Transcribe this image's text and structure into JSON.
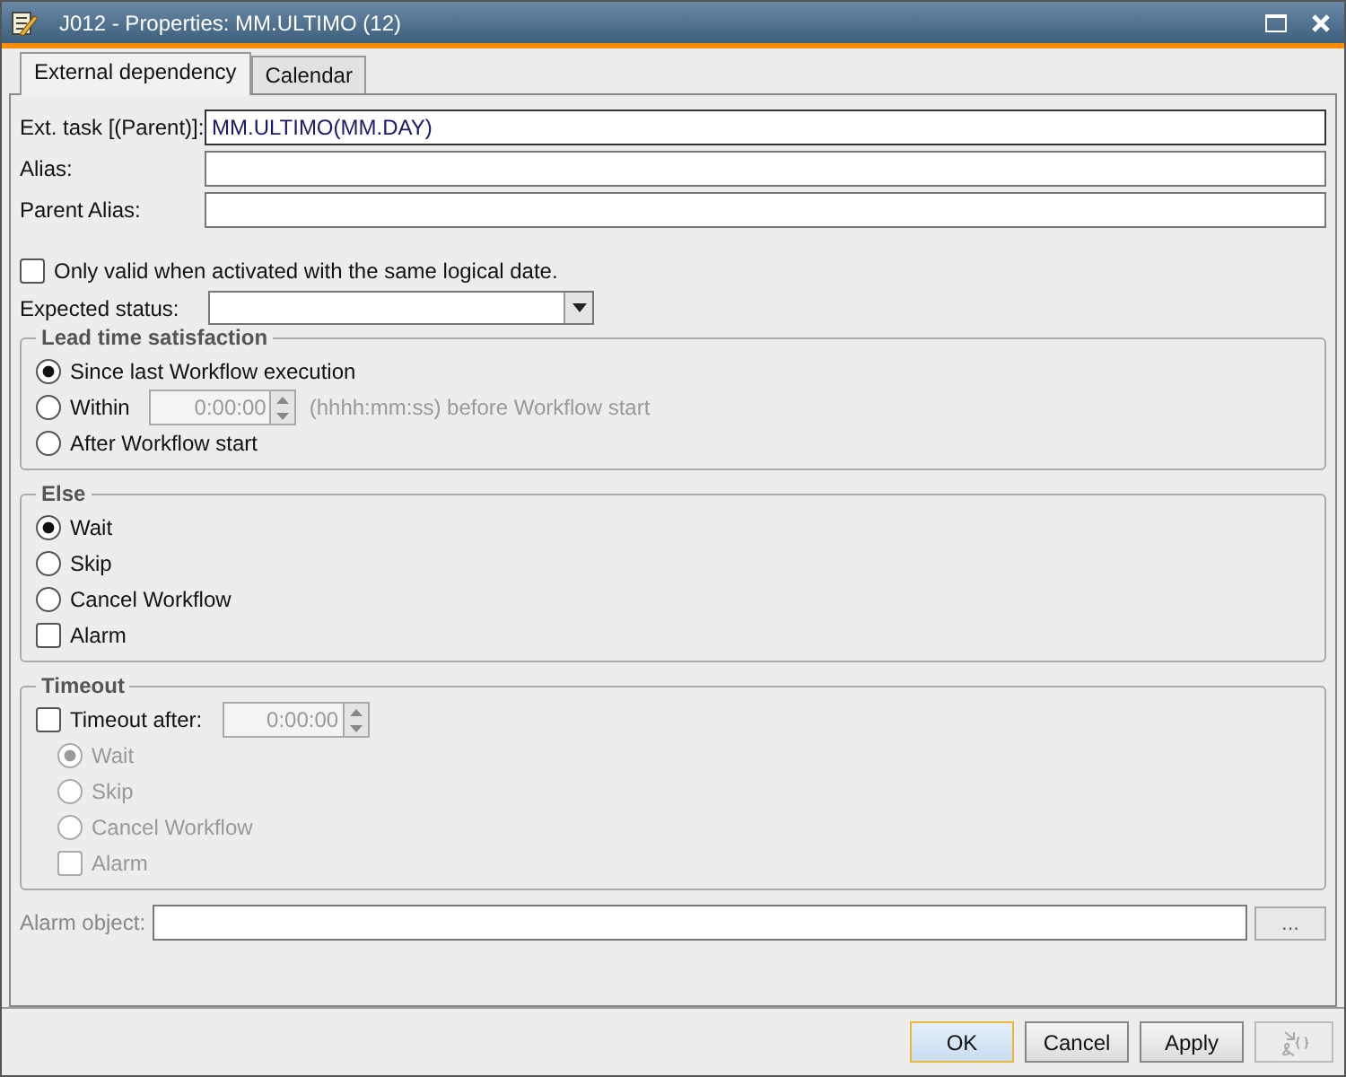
{
  "window": {
    "title": "J012 - Properties: MM.ULTIMO (12)"
  },
  "tabs": [
    {
      "label": "External dependency",
      "selected": true
    },
    {
      "label": "Calendar",
      "selected": false
    }
  ],
  "fields": [
    {
      "label": "Ext. task [(Parent)]:",
      "value": "MM.ULTIMO(MM.DAY)",
      "focused": true
    },
    {
      "label": "Alias:",
      "focused": false
    },
    {
      "label": "Parent Alias:",
      "focused": false
    }
  ],
  "same_date": {
    "label": "Only valid when activated with the same logical date.",
    "checked": false
  },
  "expected_status": {
    "label": "Expected status:"
  },
  "groups": [
    {
      "title": "Lead time satisfaction",
      "items": [
        {
          "kind": "radio",
          "label": "Since last Workflow execution",
          "selected": true
        },
        {
          "kind": "radio",
          "label": "Within",
          "selected": false,
          "spinner": {
            "value": "0:00:00",
            "disabled": true
          },
          "hint": "(hhhh:mm:ss) before Workflow start"
        },
        {
          "kind": "radio",
          "label": "After Workflow start",
          "selected": false
        }
      ]
    },
    {
      "title": "Else",
      "items": [
        {
          "kind": "radio",
          "label": "Wait",
          "selected": true
        },
        {
          "kind": "radio",
          "label": "Skip",
          "selected": false
        },
        {
          "kind": "radio",
          "label": "Cancel Workflow",
          "selected": false
        },
        {
          "kind": "checkbox",
          "label": "Alarm",
          "checked": false
        }
      ]
    },
    {
      "title": "Timeout",
      "head": {
        "kind": "checkbox",
        "label": "Timeout after:",
        "checked": false,
        "spinner": {
          "value": "0:00:00",
          "disabled": true
        }
      },
      "items": [
        {
          "kind": "radio",
          "label": "Wait",
          "selected": true,
          "disabled": true
        },
        {
          "kind": "radio",
          "label": "Skip",
          "selected": false,
          "disabled": true
        },
        {
          "kind": "radio",
          "label": "Cancel Workflow",
          "selected": false,
          "disabled": true
        },
        {
          "kind": "checkbox",
          "label": "Alarm",
          "checked": false,
          "disabled": true
        }
      ]
    }
  ],
  "alarm_object": {
    "label": "Alarm object:",
    "disabled": true,
    "button": "..."
  },
  "buttons": [
    {
      "label": "OK",
      "kind": "default",
      "disabled": false
    },
    {
      "label": "Cancel",
      "kind": "normal",
      "disabled": false
    },
    {
      "label": "Apply",
      "kind": "normal",
      "disabled": false
    },
    {
      "kind": "icon",
      "disabled": true
    }
  ]
}
